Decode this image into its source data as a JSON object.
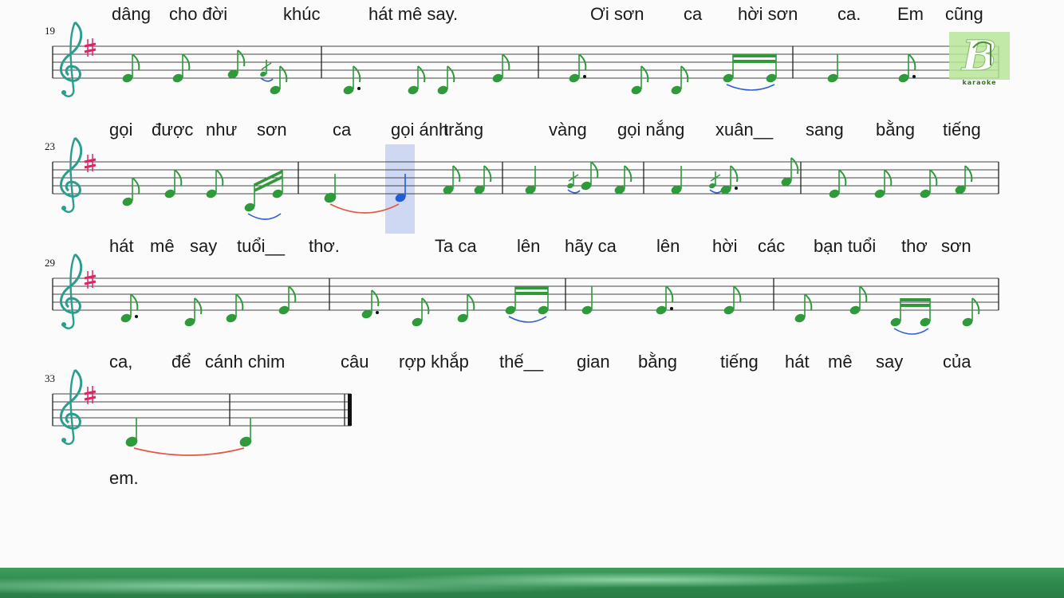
{
  "watermark": {
    "letter": "B",
    "text": "karaoke"
  },
  "systems": [
    {
      "measure_number": "19",
      "lyrics": [
        {
          "text": "dâng",
          "pos": 0.0
        },
        {
          "text": "cho đời",
          "pos": 0.0
        },
        {
          "text": "khúc",
          "pos": 0.0
        },
        {
          "text": "hát mê say.",
          "pos": 0.0
        },
        {
          "text": "Ơi sơn",
          "pos": 0.0
        },
        {
          "text": "ca",
          "pos": 0.0
        },
        {
          "text": "hời sơn",
          "pos": 0.0
        },
        {
          "text": "ca.",
          "pos": 0.0
        },
        {
          "text": "Em",
          "pos": 0.0
        },
        {
          "text": "cũng",
          "pos": 0.0
        }
      ]
    },
    {
      "measure_number": "23",
      "lyrics": [
        {
          "text": "gọi",
          "pos": 0.0
        },
        {
          "text": "được",
          "pos": 0.0
        },
        {
          "text": "như",
          "pos": 0.0
        },
        {
          "text": "sơn",
          "pos": 0.0
        },
        {
          "text": "ca",
          "pos": 0.0
        },
        {
          "text": "gọi ánh",
          "pos": 0.0
        },
        {
          "text": "trăng",
          "pos": 0.0
        },
        {
          "text": "vàng",
          "pos": 0.0
        },
        {
          "text": "gọi nắng",
          "pos": 0.0
        },
        {
          "text": "xuân__",
          "pos": 0.0
        },
        {
          "text": "sang",
          "pos": 0.0
        },
        {
          "text": "bằng",
          "pos": 0.0
        },
        {
          "text": "tiếng",
          "pos": 0.0
        }
      ]
    },
    {
      "measure_number": "29",
      "lyrics": [
        {
          "text": "hát",
          "pos": 0.0
        },
        {
          "text": "mê",
          "pos": 0.0
        },
        {
          "text": "say",
          "pos": 0.0
        },
        {
          "text": "tuổi__",
          "pos": 0.0
        },
        {
          "text": "thơ.",
          "pos": 0.0
        },
        {
          "text": "Ta ca",
          "pos": 0.0
        },
        {
          "text": "lên",
          "pos": 0.0
        },
        {
          "text": "hãy ca",
          "pos": 0.0
        },
        {
          "text": "lên",
          "pos": 0.0
        },
        {
          "text": "hời",
          "pos": 0.0
        },
        {
          "text": "các",
          "pos": 0.0
        },
        {
          "text": "bạn tuổi",
          "pos": 0.0
        },
        {
          "text": "thơ",
          "pos": 0.0
        },
        {
          "text": "sơn",
          "pos": 0.0
        }
      ]
    },
    {
      "measure_number": "33",
      "lyrics": [
        {
          "text": "ca,",
          "pos": 0.0
        },
        {
          "text": "để",
          "pos": 0.0
        },
        {
          "text": "cánh chim",
          "pos": 0.0
        },
        {
          "text": "câu",
          "pos": 0.0
        },
        {
          "text": "rợp khắp",
          "pos": 0.0
        },
        {
          "text": "thế__",
          "pos": 0.0
        },
        {
          "text": "gian",
          "pos": 0.0
        },
        {
          "text": "bằng",
          "pos": 0.0
        },
        {
          "text": "tiếng",
          "pos": 0.0
        },
        {
          "text": "hát",
          "pos": 0.0
        },
        {
          "text": "mê",
          "pos": 0.0
        },
        {
          "text": "say",
          "pos": 0.0
        },
        {
          "text": "của",
          "pos": 0.0
        }
      ]
    },
    {
      "measure_number": "",
      "lyrics": [
        {
          "text": "em.",
          "pos": 0.0
        }
      ]
    }
  ],
  "colors": {
    "note": "#2e9a3a",
    "highlight_note": "#1f5fd6",
    "highlight_box": "#cfd8f2",
    "tie": "#e05a4a",
    "slur": "#2f5fd0",
    "clef": "#2a9d8f",
    "sharp": "#e0246a"
  }
}
